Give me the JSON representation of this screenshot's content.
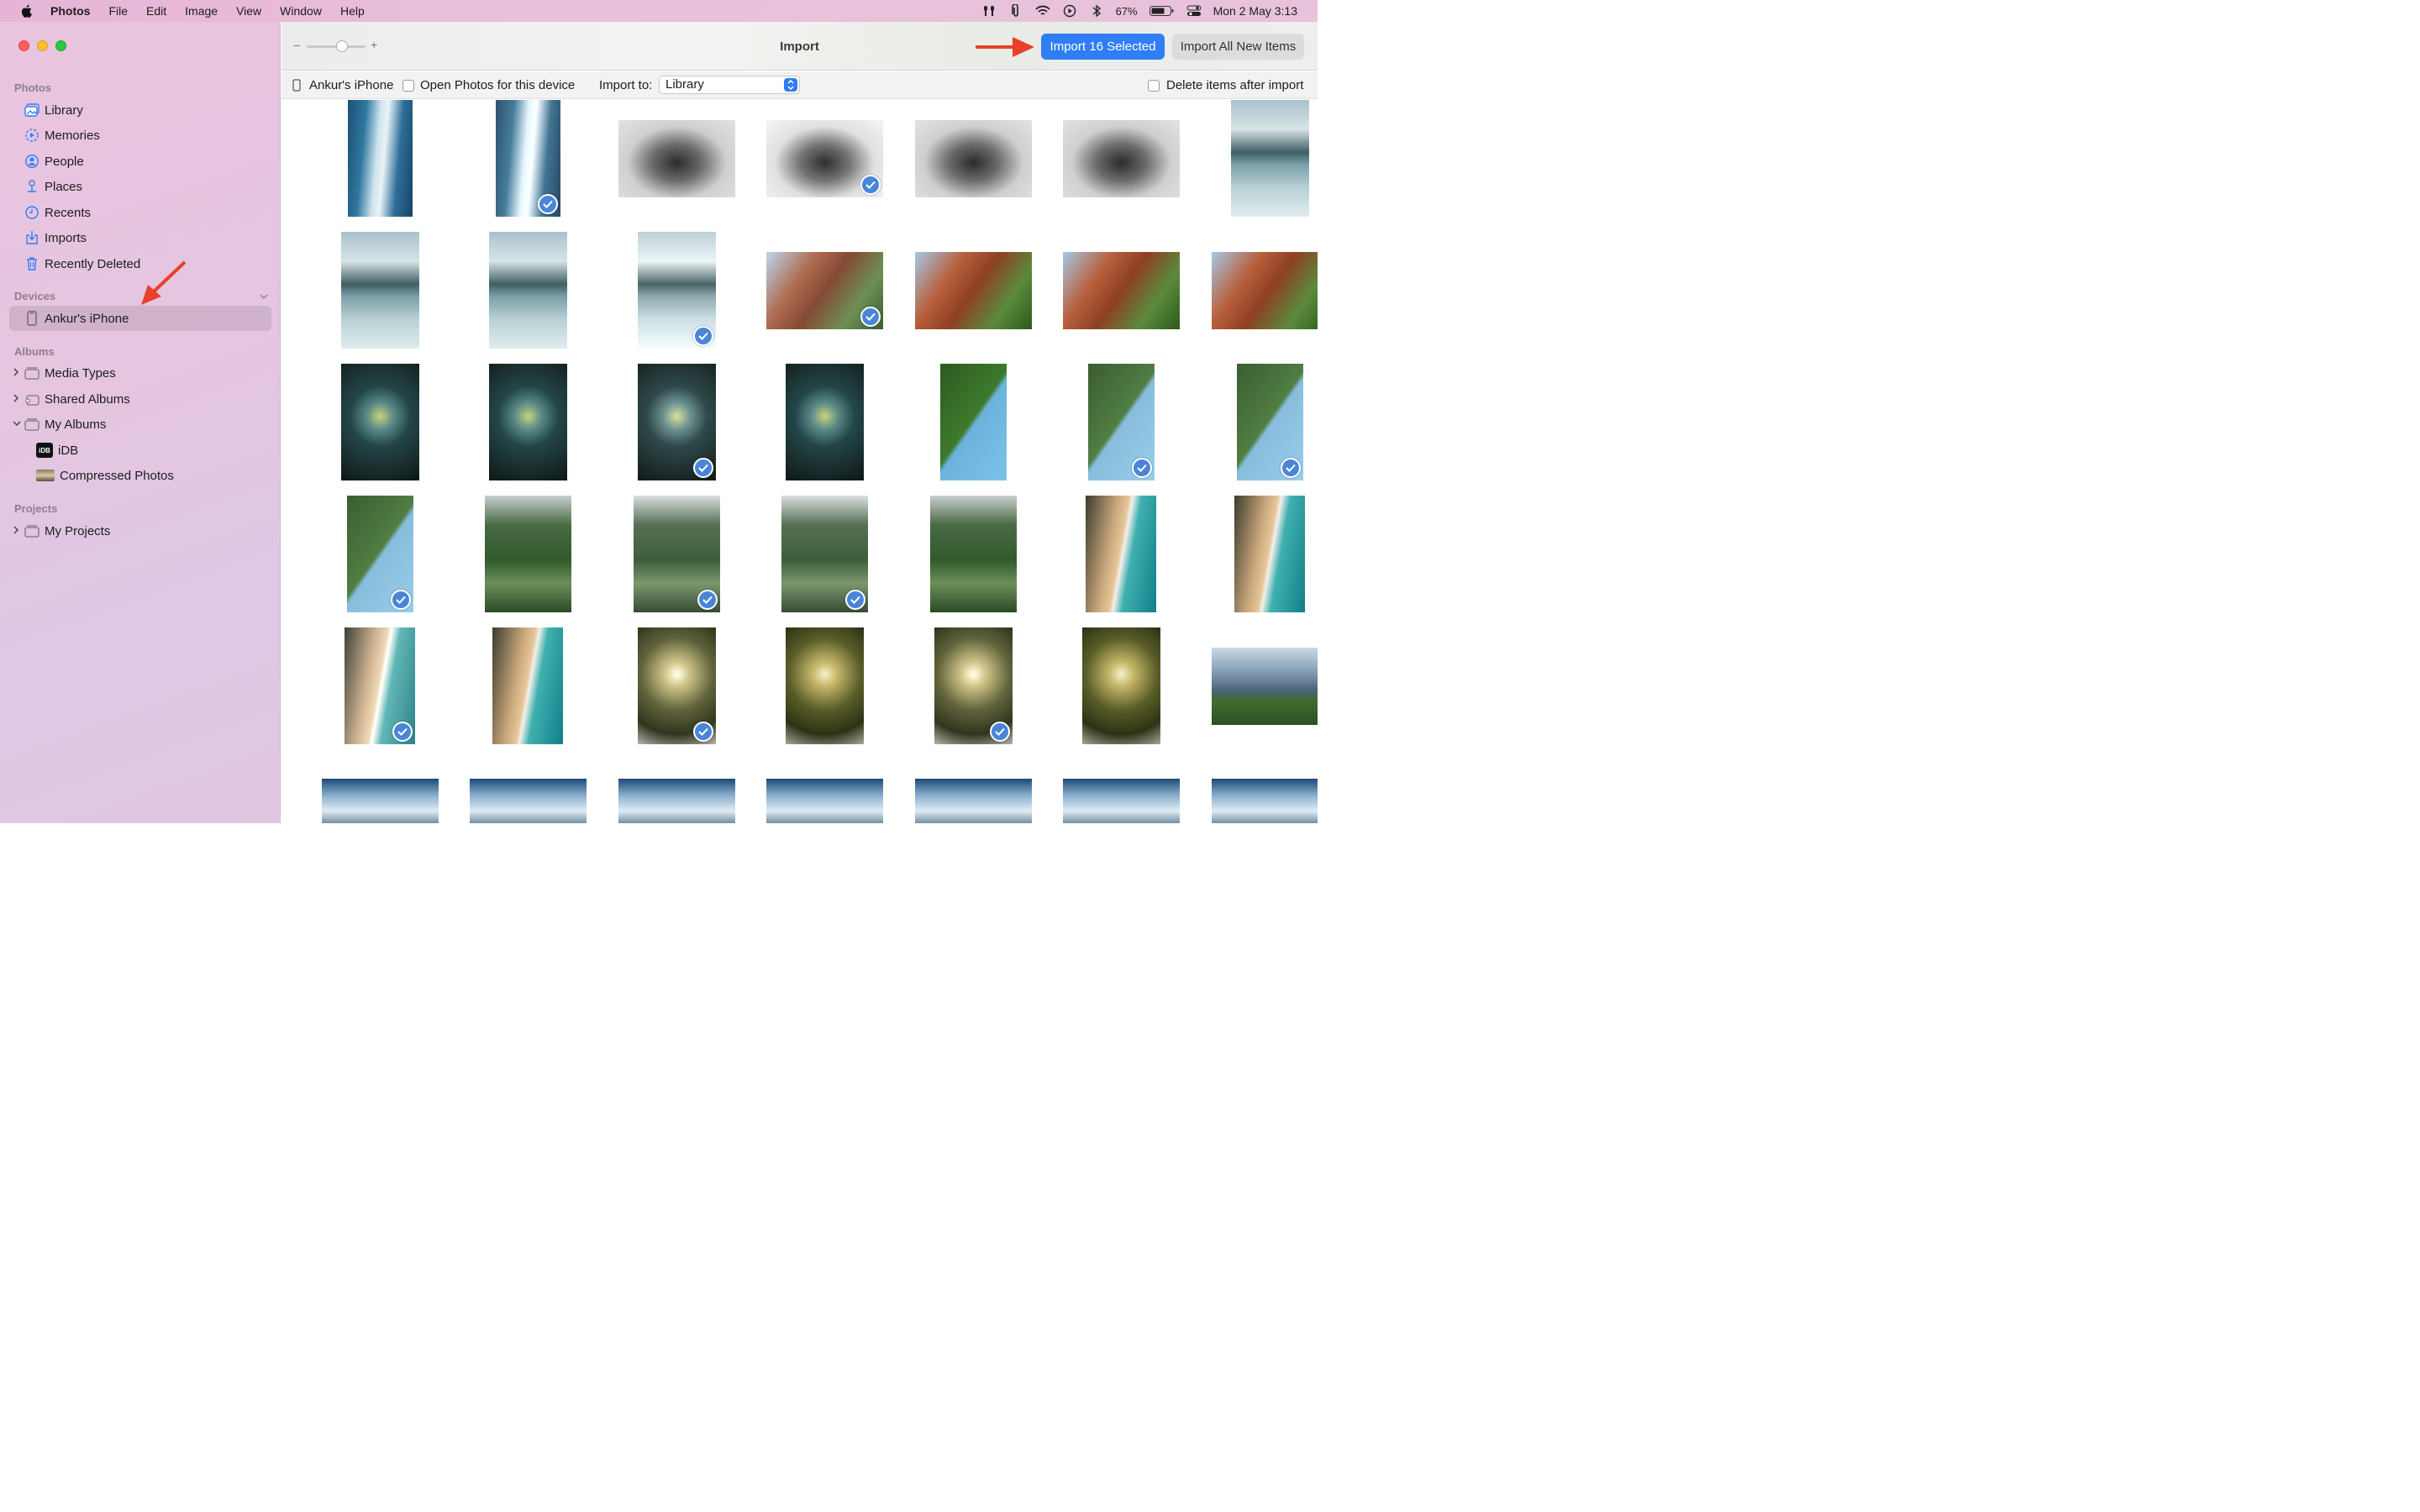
{
  "menubar": {
    "app": "Photos",
    "items": [
      "File",
      "Edit",
      "Image",
      "View",
      "Window",
      "Help"
    ],
    "battery": "67%",
    "clock": "Mon 2 May  3:13"
  },
  "sidebar": {
    "photos_title": "Photos",
    "photos_items": [
      "Library",
      "Memories",
      "People",
      "Places",
      "Recents",
      "Imports",
      "Recently Deleted"
    ],
    "devices_title": "Devices",
    "device": "Ankur's iPhone",
    "albums_title": "Albums",
    "albums": [
      "Media Types",
      "Shared Albums",
      "My Albums"
    ],
    "my_albums_children": [
      "iDB",
      "Compressed Photos"
    ],
    "projects_title": "Projects",
    "projects": [
      "My Projects"
    ],
    "idb_badge": "iDB"
  },
  "toolbar": {
    "title": "Import",
    "import_selected": "Import 16 Selected",
    "import_all": "Import All New Items",
    "zoom_level": 0.6
  },
  "subbar": {
    "device": "Ankur's iPhone",
    "open_photos": "Open Photos for this device",
    "import_to_label": "Import to:",
    "import_to_value": "Library",
    "delete_after": "Delete items after import"
  },
  "colors": {
    "accent": "#2f7ef5",
    "annotation_arrow": "#e8402a"
  },
  "photos": [
    {
      "kind": "wave",
      "checked": false
    },
    {
      "kind": "wave",
      "checked": true
    },
    {
      "kind": "mountain-fog",
      "checked": false
    },
    {
      "kind": "mountain-fog",
      "checked": true
    },
    {
      "kind": "mountain-fog",
      "checked": false
    },
    {
      "kind": "mountain-fog",
      "checked": false
    },
    {
      "kind": "lake",
      "checked": false
    },
    {
      "kind": "lake",
      "checked": false
    },
    {
      "kind": "lake",
      "checked": false
    },
    {
      "kind": "lake",
      "checked": true
    },
    {
      "kind": "cliff",
      "checked": true
    },
    {
      "kind": "cliff",
      "checked": false
    },
    {
      "kind": "cliff",
      "checked": false
    },
    {
      "kind": "cliff",
      "checked": false
    },
    {
      "kind": "forest",
      "checked": false
    },
    {
      "kind": "forest",
      "checked": false
    },
    {
      "kind": "forest",
      "checked": true
    },
    {
      "kind": "forest",
      "checked": false
    },
    {
      "kind": "hill-sky",
      "checked": false
    },
    {
      "kind": "hill-sky",
      "checked": true
    },
    {
      "kind": "hill-sky",
      "checked": true
    },
    {
      "kind": "hill-sky",
      "checked": true
    },
    {
      "kind": "valley",
      "checked": false
    },
    {
      "kind": "valley",
      "checked": true
    },
    {
      "kind": "valley",
      "checked": true
    },
    {
      "kind": "valley",
      "checked": false
    },
    {
      "kind": "beach",
      "checked": false
    },
    {
      "kind": "beach",
      "checked": false
    },
    {
      "kind": "beach",
      "checked": true
    },
    {
      "kind": "beach",
      "checked": false
    },
    {
      "kind": "tree",
      "checked": true
    },
    {
      "kind": "tree",
      "checked": false
    },
    {
      "kind": "tree",
      "checked": true
    },
    {
      "kind": "tree",
      "checked": false
    },
    {
      "kind": "meadow",
      "checked": false
    },
    {
      "kind": "sky-mtn",
      "checked": false
    },
    {
      "kind": "sky-mtn",
      "checked": false
    },
    {
      "kind": "sky-mtn",
      "checked": false
    },
    {
      "kind": "sky-mtn",
      "checked": false
    },
    {
      "kind": "sky-mtn",
      "checked": false
    },
    {
      "kind": "sky-mtn",
      "checked": false
    },
    {
      "kind": "sky-mtn",
      "checked": false
    }
  ]
}
